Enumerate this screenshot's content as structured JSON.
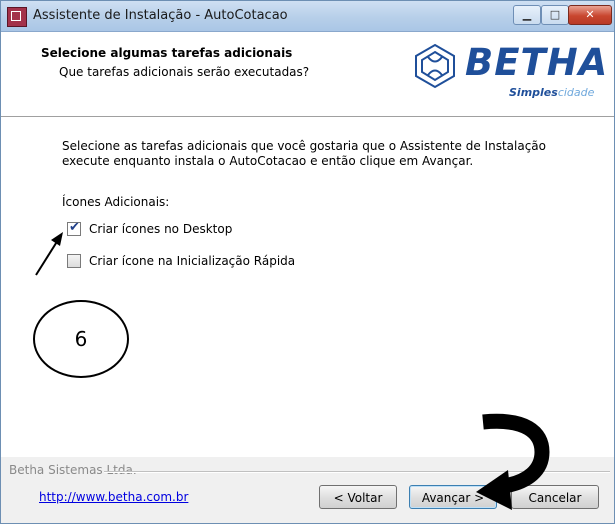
{
  "window": {
    "title": "Assistente de Instalação - AutoCotacao",
    "controls": {
      "minimize": "▁",
      "maximize": "□",
      "close": "✕"
    }
  },
  "header": {
    "title": "Selecione algumas tarefas adicionais",
    "subtitle": "Que tarefas adicionais serão executadas?",
    "logo": {
      "word": "BETHA",
      "tag_bold": "Simples",
      "tag_light": "cidade"
    }
  },
  "content": {
    "description": "Selecione as tarefas adicionais que você gostaria que o Assistente de Instalação execute enquanto instala o AutoCotacao e então clique em Avançar.",
    "group_label": "Ícones Adicionais:",
    "options": [
      {
        "label": "Criar ícones no Desktop",
        "checked": true
      },
      {
        "label": "Criar ícone na Inicialização Rápida",
        "checked": false
      }
    ]
  },
  "annotation": {
    "number": "6"
  },
  "footer": {
    "company": "Betha Sistemas Ltda.",
    "link": "http://www.betha.com.br",
    "buttons": {
      "back": "< Voltar",
      "next": "Avançar >",
      "cancel": "Cancelar"
    }
  }
}
